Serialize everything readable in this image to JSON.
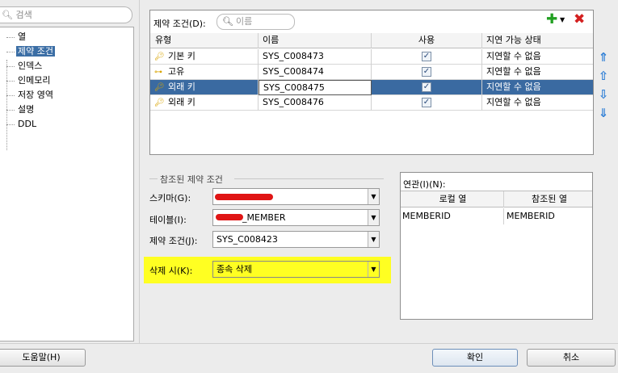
{
  "left": {
    "search_placeholder": "검색",
    "tree_items": [
      "열",
      "제약 조건",
      "인덱스",
      "인메모리",
      "저장 영역",
      "설명",
      "DDL"
    ]
  },
  "constraints": {
    "label": "제약 조건(D):",
    "search_placeholder": "이름",
    "columns": [
      "유형",
      "이름",
      "사용",
      "지연 가능 상태"
    ],
    "rows": [
      {
        "type": "기본 키",
        "name": "SYS_C008473",
        "enabled": true,
        "deferrable": "지연할 수 없음"
      },
      {
        "type": "고유",
        "name": "SYS_C008474",
        "enabled": true,
        "deferrable": "지연할 수 없음"
      },
      {
        "type": "외래 키",
        "name": "SYS_C008475",
        "enabled": true,
        "deferrable": "지연할 수 없음"
      },
      {
        "type": "외래 키",
        "name": "SYS_C008476",
        "enabled": true,
        "deferrable": "지연할 수 없음"
      }
    ],
    "selected_row": 2,
    "icons": {
      "add": "plus-icon",
      "remove": "delete-icon",
      "move": [
        "move-top-icon",
        "move-up-icon",
        "move-down-icon",
        "move-bottom-icon"
      ]
    }
  },
  "referenced": {
    "title": "참조된 제약 조건",
    "schema_label": "스키마(G):",
    "schema_value": "",
    "table_label": "테이블(I):",
    "table_value": "_MEMBER",
    "constraint_label": "제약 조건(J):",
    "constraint_value": "SYS_C008423",
    "on_delete_label": "삭제 시(K):",
    "on_delete_value": "종속 삭제"
  },
  "linked": {
    "label": "연관(I)(N):",
    "columns": [
      "로컬 열",
      "참조된 열"
    ],
    "rows": [
      {
        "local": "MEMBERID",
        "referenced": "MEMBERID"
      }
    ]
  },
  "buttons": {
    "help": "도움말(H)",
    "ok": "확인",
    "cancel": "취소"
  },
  "colors": {
    "highlight": "#ffff22",
    "selection": "#3a6aa1",
    "redaction": "#e01515"
  }
}
